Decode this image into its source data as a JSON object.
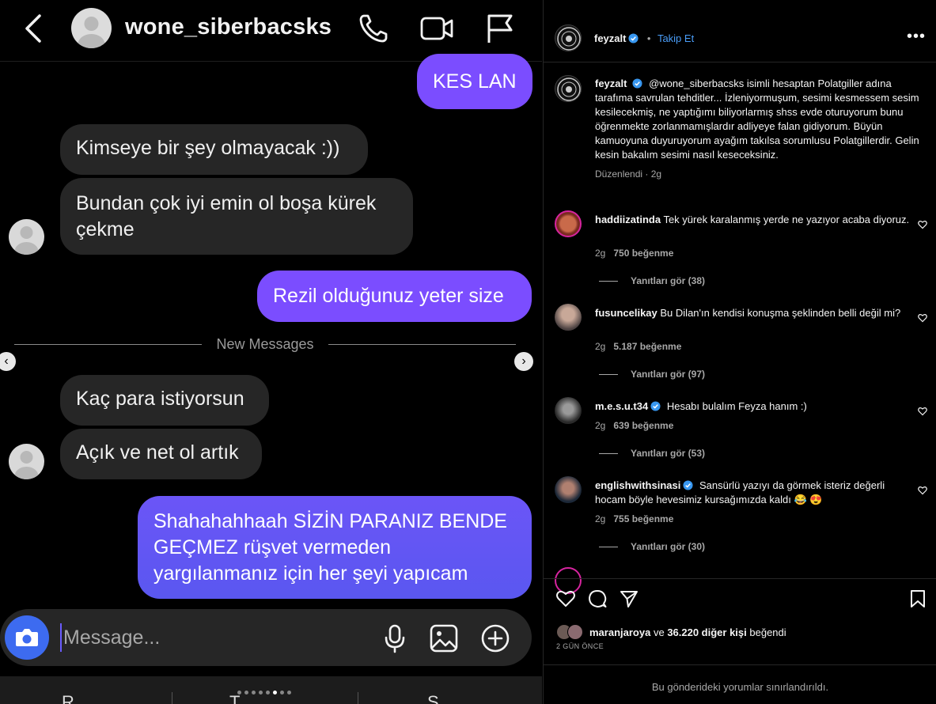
{
  "chat": {
    "header": {
      "username": "wone_siberbacsks"
    },
    "messages": {
      "m1": "KES LAN",
      "m2": "Kimseye bir şey olmayacak :))",
      "m3a": "Bundan çok iyi emin ol boşa kürek",
      "m3b": "çekme",
      "m4": "Rezil olduğunuz yeter size",
      "m5": "Kaç para istiyorsun",
      "m6": "Açık ve net ol artık",
      "m7a": "Shahahahhaah SİZİN PARANIZ BENDE",
      "m7b": "GEÇMEZ rüşvet vermeden",
      "m7c": "yargılanmanız için her şeyi yapıcam"
    },
    "divider": "New Messages",
    "composer": {
      "placeholder": "Message..."
    },
    "bottom_bar": {
      "c1": "R",
      "c2": "T",
      "c3": "S"
    },
    "colors": {
      "outgoing": "#7b4dff",
      "outgoing_end": "#5a57f0",
      "incoming": "#262626",
      "camera": "#3d6bf0"
    }
  },
  "post": {
    "author": "feyzalt",
    "dot": "•",
    "follow": "Takip Et",
    "caption": "@wone_siberbacsks isimli hesaptan Polatgiller adına tarafıma savrulan tehditler... İzleniyormuşum, sesimi kesmessem sesim kesilecekmiş, ne yaptığımı biliyorlarmış shss evde oturuyorum bunu öğrenmekte zorlanmamışlardır adliyeye falan gidiyorum. Büyün kamuoyuna duyuruyorum ayağım takılsa sorumlusu Polatgillerdir. Gelin kesin bakalım sesimi nasıl keseceksiniz.",
    "caption_meta": "Düzenlendi · 2g",
    "comments": [
      {
        "user": "haddiizatinda",
        "text": "Tek yürek karalanmış yerde ne yazıyor acaba diyoruz.",
        "time": "2g",
        "likes": "750 beğenme",
        "replies": "Yanıtları gör (38)"
      },
      {
        "user": "fusuncelikay",
        "text": "Bu Dilan'ın kendisi konuşma şeklinden belli değil mi?",
        "time": "2g",
        "likes": "5.187 beğenme",
        "replies": "Yanıtları gör (97)"
      },
      {
        "user": "m.e.s.u.t34",
        "text": "Hesabı bulalım Feyza hanım :)",
        "time": "2g",
        "likes": "639 beğenme",
        "replies": "Yanıtları gör (53)"
      },
      {
        "user": "englishwithsinasi",
        "text": "Sansürlü yazıyı da görmek isteriz değerli hocam böyle hevesimiz kursağımızda kaldı 😂 😍",
        "time": "2g",
        "likes": "755 beğenme",
        "replies": "Yanıtları gör (30)"
      }
    ],
    "likes": {
      "user": "maranjaroya",
      "mid": "ve",
      "count": "36.220 diğer kişi",
      "suffix": "beğendi"
    },
    "date": "2 GÜN ÖNCE",
    "restricted": "Bu gönderideki yorumlar sınırlandırıldı.",
    "colors": {
      "link": "#4a9df8",
      "verified": "#3897f0",
      "secondary": "#a8a8a8"
    }
  }
}
